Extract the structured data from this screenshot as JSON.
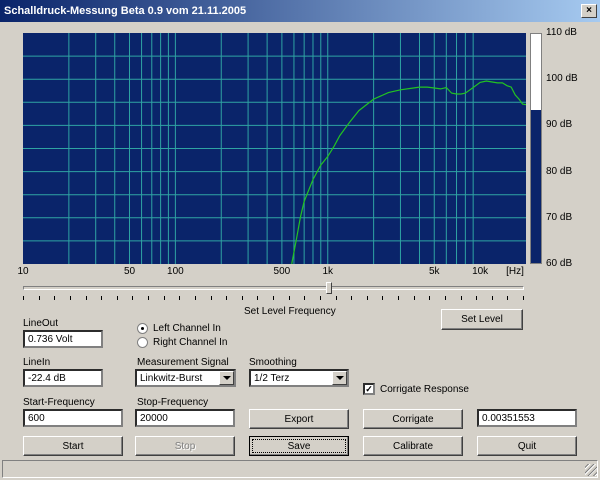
{
  "window": {
    "title": "Schalldruck-Messung Beta 0.9 vom 21.11.2005",
    "close_label": "×"
  },
  "chart_data": {
    "type": "line",
    "xscale": "log",
    "xlim": [
      10,
      20000
    ],
    "ylim": [
      60,
      110
    ],
    "x_ticks": [
      "10",
      "50",
      "100",
      "500",
      "1k",
      "5k",
      "10k",
      "[Hz]"
    ],
    "y_ticks": [
      "110 dB",
      "100 dB",
      "90 dB",
      "80 dB",
      "70 dB",
      "60 dB"
    ],
    "grid": true,
    "colors": {
      "background": "#0a246a",
      "grid": "#2fa3a3",
      "line": "#22c322"
    },
    "series": [
      {
        "x": [
          580,
          620,
          660,
          700,
          750,
          800,
          900,
          1000,
          1100,
          1200,
          1400,
          1600,
          2000,
          2500,
          3000,
          3500,
          4000,
          4500,
          5000,
          5500,
          6000,
          6500,
          7000,
          7500,
          8000,
          9000,
          10000,
          11000,
          12000,
          13000,
          14000,
          15000,
          16000,
          17000,
          18000,
          19000,
          20000
        ],
        "y": [
          60,
          65,
          70,
          73.5,
          76,
          78.3,
          81.4,
          83.3,
          85.5,
          87.8,
          90.8,
          93.2,
          95.7,
          97.1,
          97.7,
          98.0,
          98.3,
          98.3,
          98.1,
          97.9,
          98.2,
          97.0,
          96.8,
          96.8,
          97.0,
          98.2,
          99.3,
          99.6,
          99.4,
          99.2,
          99.2,
          98.6,
          98.3,
          96.6,
          95.7,
          94.6,
          94.5
        ]
      }
    ]
  },
  "level_meter": {
    "value_db": 93.5,
    "min_db": 60,
    "max_db": 110
  },
  "slider": {
    "label": "Set Level Frequency",
    "value_fraction": 0.61
  },
  "buttons": {
    "set_level": "Set Level",
    "export": "Export",
    "corrigate": "Corrigate",
    "start": "Start",
    "stop": "Stop",
    "save": "Save",
    "calibrate": "Calibrate",
    "quit": "Quit"
  },
  "fields": {
    "lineout_label": "LineOut",
    "lineout_value": "0.736 Volt",
    "linein_label": "LineIn",
    "linein_value": "-22.4 dB",
    "start_freq_label": "Start-Frequency",
    "start_freq_value": "600",
    "stop_freq_label": "Stop-Frequency",
    "stop_freq_value": "20000",
    "corrigate_value": "0.00351553"
  },
  "channels": {
    "left": "Left Channel In",
    "right": "Right Channel In",
    "selected": "left"
  },
  "measurement_signal": {
    "label": "Measurement Signal",
    "value": "Linkwitz-Burst"
  },
  "smoothing": {
    "label": "Smoothing",
    "value": "1/2 Terz"
  },
  "corrigate_response": {
    "label": "Corrigate Response",
    "checked": true
  }
}
